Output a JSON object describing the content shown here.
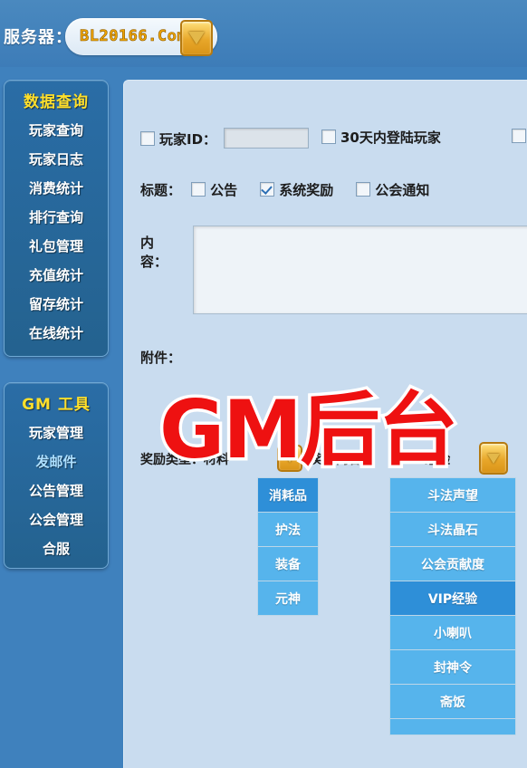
{
  "header": {
    "server_label": "服务器：",
    "server_value": "BL20166.Com",
    "dropdown_icon": "chevron-down-icon"
  },
  "sidebar": {
    "groups": [
      {
        "title": "数据查询",
        "items": [
          {
            "label": "玩家查询",
            "active": false
          },
          {
            "label": "玩家日志",
            "active": false
          },
          {
            "label": "消费统计",
            "active": false
          },
          {
            "label": "排行查询",
            "active": false
          },
          {
            "label": "礼包管理",
            "active": false
          },
          {
            "label": "充值统计",
            "active": false
          },
          {
            "label": "留存统计",
            "active": false
          },
          {
            "label": "在线统计",
            "active": false
          }
        ]
      },
      {
        "title": "GM 工具",
        "items": [
          {
            "label": "玩家管理",
            "active": false
          },
          {
            "label": "发邮件",
            "active": true
          },
          {
            "label": "公告管理",
            "active": false
          },
          {
            "label": "公会管理",
            "active": false
          },
          {
            "label": "合服",
            "active": false
          }
        ]
      }
    ]
  },
  "form": {
    "player_id": {
      "label": "玩家ID：",
      "checked": false,
      "value": "",
      "placeholder": ""
    },
    "login30": {
      "label": "30天内登陆玩家",
      "checked": false
    },
    "extra_checkbox": {
      "label": "",
      "checked": false
    },
    "title": {
      "label": "标题：",
      "options": [
        {
          "label": "公告",
          "checked": false
        },
        {
          "label": "系统奖励",
          "checked": true
        },
        {
          "label": "公会通知",
          "checked": false
        }
      ]
    },
    "content": {
      "label": "内容：",
      "value": "",
      "placeholder": ""
    },
    "attachment": {
      "label": "附件："
    },
    "reward": {
      "type_label": "奖励类型：材料",
      "content_label": "奖励内容：",
      "value_label": "VIP经验",
      "type_dropdown_icon": "chevron-down-icon",
      "value_dropdown_icon": "chevron-down-icon"
    }
  },
  "reward_category_buttons": [
    {
      "label": "消耗品",
      "selected": true
    },
    {
      "label": "护法",
      "selected": false
    },
    {
      "label": "装备",
      "selected": false
    },
    {
      "label": "元神",
      "selected": false
    }
  ],
  "reward_item_buttons": [
    {
      "label": "斗法声望",
      "selected": false
    },
    {
      "label": "斗法晶石",
      "selected": false
    },
    {
      "label": "公会贡献度",
      "selected": false
    },
    {
      "label": "VIP经验",
      "selected": true
    },
    {
      "label": "小喇叭",
      "selected": false
    },
    {
      "label": "封神令",
      "selected": false
    },
    {
      "label": "斋饭",
      "selected": false
    },
    {
      "label": "",
      "selected": false
    }
  ],
  "watermark": {
    "text": "GM后台",
    "color": "#ee1111"
  },
  "colors": {
    "page_background": "#3f81bd",
    "panel_background": "#c9dcef",
    "sidebar_group": "#2a6da6",
    "group_title": "#ffdf2b",
    "active_item": "#aee0ff",
    "tile": "#56b4ec",
    "tile_selected": "#2e8fd8",
    "server_value": "#f0a500"
  }
}
